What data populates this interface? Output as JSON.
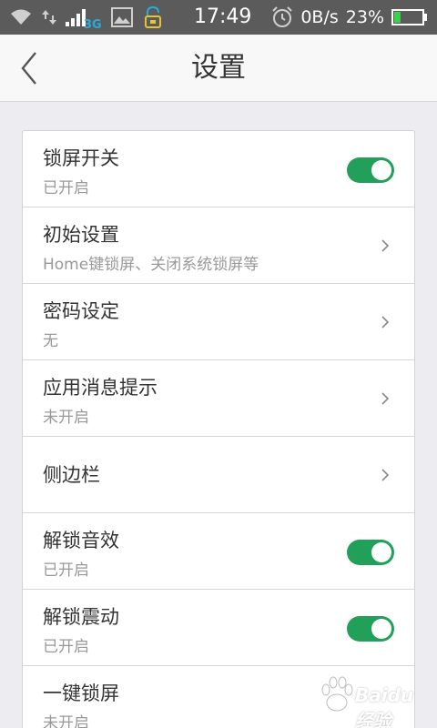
{
  "status_bar": {
    "network_type": "3G",
    "time": "17:49",
    "speed": "0B/s",
    "battery": "23%",
    "battery_level": 0.23
  },
  "header": {
    "title": "设置"
  },
  "settings": [
    {
      "title": "锁屏开关",
      "subtitle": "已开启",
      "control": "toggle",
      "on": true
    },
    {
      "title": "初始设置",
      "subtitle": "Home键锁屏、关闭系统锁屏等",
      "control": "chevron"
    },
    {
      "title": "密码设定",
      "subtitle": "无",
      "control": "chevron"
    },
    {
      "title": "应用消息提示",
      "subtitle": "未开启",
      "control": "chevron"
    },
    {
      "title": "侧边栏",
      "control": "chevron"
    },
    {
      "title": "解锁音效",
      "subtitle": "已开启",
      "control": "toggle",
      "on": true
    },
    {
      "title": "解锁震动",
      "subtitle": "已开启",
      "control": "toggle",
      "on": true
    },
    {
      "title": "一键锁屏",
      "subtitle": "未开启",
      "control": "chevron"
    }
  ],
  "watermark": {
    "text": "Baidu 经验"
  },
  "colors": {
    "toggle_on": "#22a05a",
    "status_bar": "#5b5b5b",
    "network_3g": "#29a9e0"
  }
}
